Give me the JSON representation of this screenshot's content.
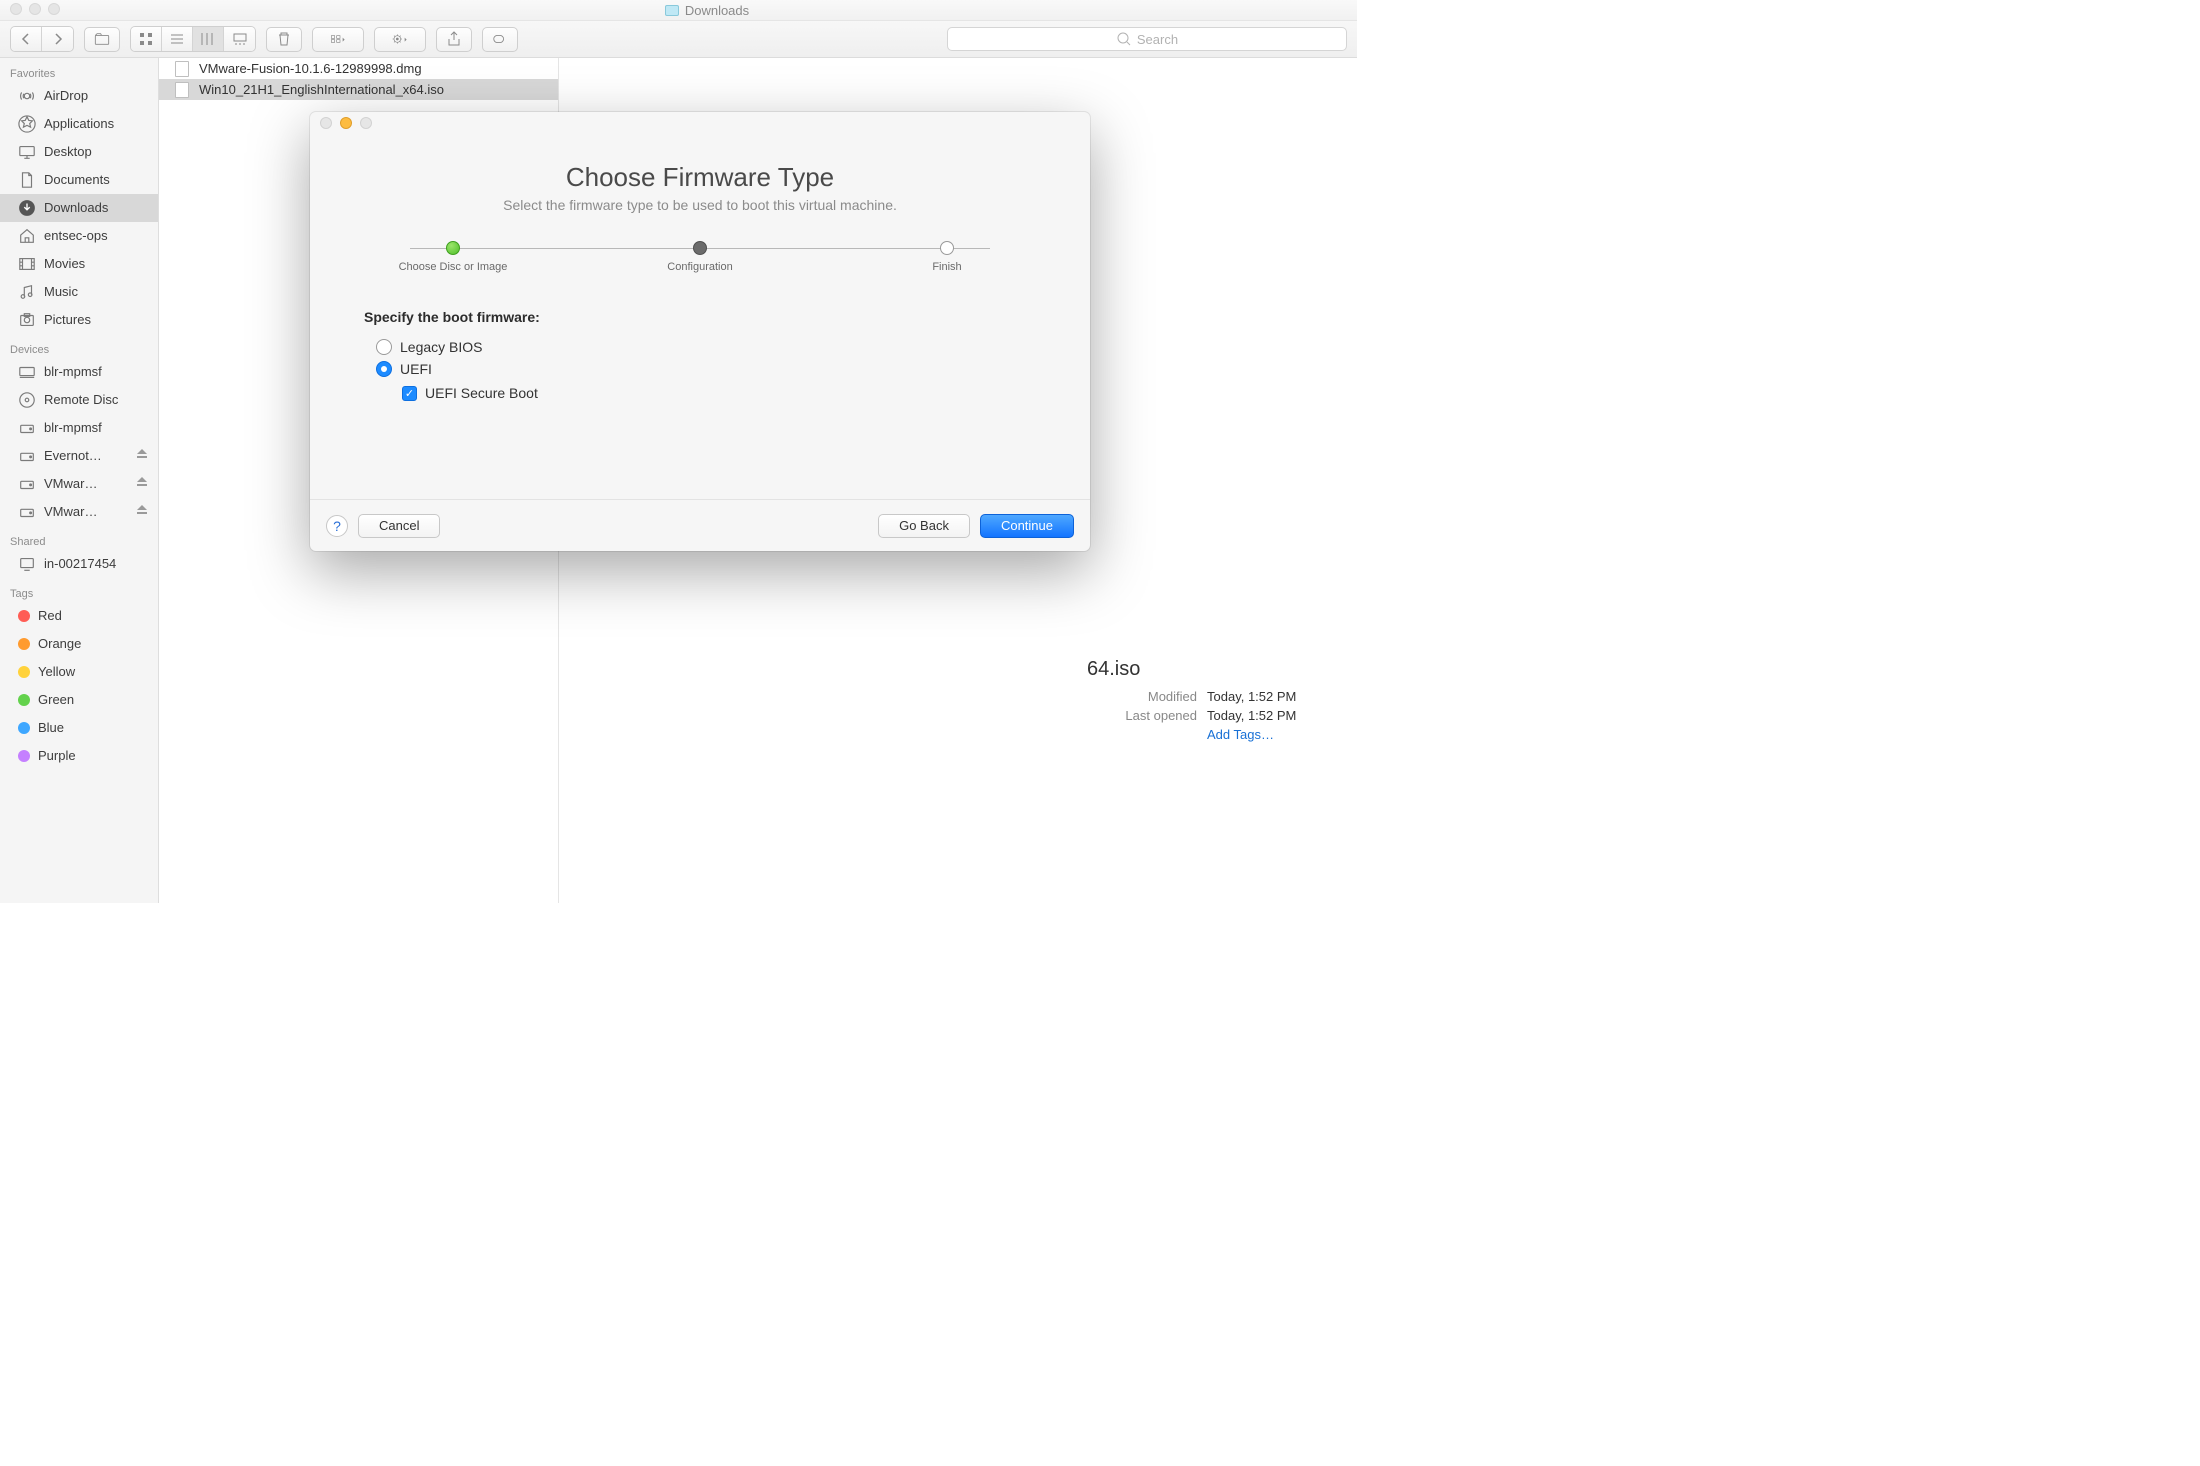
{
  "finder": {
    "window_title": "Downloads",
    "search_placeholder": "Search",
    "sidebar": {
      "favorites_label": "Favorites",
      "devices_label": "Devices",
      "shared_label": "Shared",
      "tags_label": "Tags",
      "favorites": [
        {
          "label": "AirDrop",
          "icon": "airdrop"
        },
        {
          "label": "Applications",
          "icon": "apps"
        },
        {
          "label": "Desktop",
          "icon": "desktop"
        },
        {
          "label": "Documents",
          "icon": "docs"
        },
        {
          "label": "Downloads",
          "icon": "downloads",
          "selected": true
        },
        {
          "label": "entsec-ops",
          "icon": "home"
        },
        {
          "label": "Movies",
          "icon": "movies"
        },
        {
          "label": "Music",
          "icon": "music"
        },
        {
          "label": "Pictures",
          "icon": "pictures"
        }
      ],
      "devices": [
        {
          "label": "blr-mpmsf",
          "icon": "computer"
        },
        {
          "label": "Remote Disc",
          "icon": "disc"
        },
        {
          "label": "blr-mpmsf",
          "icon": "drive"
        },
        {
          "label": "Evernot…",
          "icon": "drive",
          "eject": true
        },
        {
          "label": "VMwar…",
          "icon": "drive",
          "eject": true
        },
        {
          "label": "VMwar…",
          "icon": "drive",
          "eject": true
        }
      ],
      "shared": [
        {
          "label": "in-00217454",
          "icon": "screen"
        }
      ],
      "tags": [
        {
          "label": "Red",
          "color": "#ff5d55"
        },
        {
          "label": "Orange",
          "color": "#ff9b2f"
        },
        {
          "label": "Yellow",
          "color": "#ffd23b"
        },
        {
          "label": "Green",
          "color": "#63d24c"
        },
        {
          "label": "Blue",
          "color": "#3ea7ff"
        },
        {
          "label": "Purple",
          "color": "#c580ff"
        }
      ]
    },
    "files": [
      {
        "name": "VMware-Fusion-10.1.6-12989998.dmg"
      },
      {
        "name": "Win10_21H1_EnglishInternational_x64.iso",
        "selected": true
      }
    ],
    "preview": {
      "title_suffix": "64.iso",
      "modified_label": "Modified",
      "modified_value": "Today, 1:52 PM",
      "lastopened_label": "Last opened",
      "lastopened_value": "Today, 1:52 PM",
      "add_tags": "Add Tags…"
    }
  },
  "dialog": {
    "title": "Choose Firmware Type",
    "subtitle": "Select the firmware type to be used to boot this virtual machine.",
    "steps": [
      {
        "label": "Choose Disc or Image",
        "state": "done"
      },
      {
        "label": "Configuration",
        "state": "current"
      },
      {
        "label": "Finish",
        "state": "future"
      }
    ],
    "section_title": "Specify the boot firmware:",
    "option_legacy": "Legacy BIOS",
    "option_uefi": "UEFI",
    "option_secure": "UEFI Secure Boot",
    "selected_option": "uefi",
    "secure_boot_checked": true,
    "help_label": "?",
    "cancel": "Cancel",
    "goback": "Go Back",
    "continue": "Continue"
  }
}
